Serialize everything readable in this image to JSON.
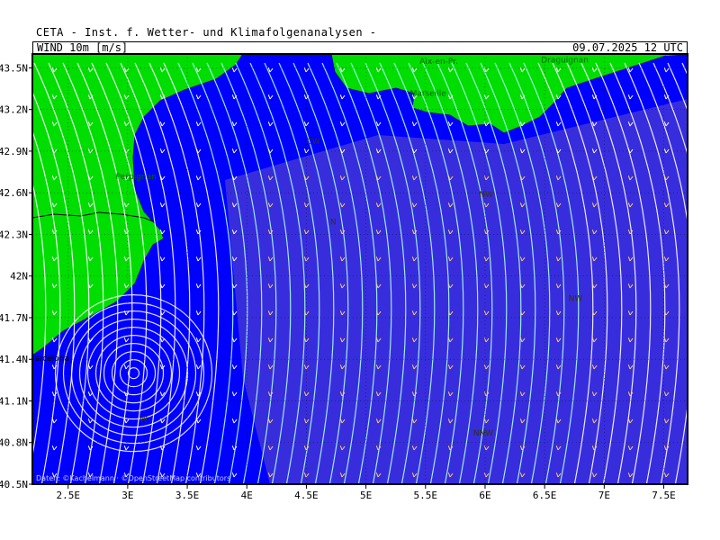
{
  "header": {
    "title": "CETA - Inst. f. Wetter- und Klimafolgenanalysen -",
    "variable": "WIND 10m [m/s]",
    "valid_time": "09.07.2025 12 UTC"
  },
  "map": {
    "lon_range": [
      2.2,
      7.7
    ],
    "lat_range": [
      40.5,
      43.6
    ],
    "lon_ticks": [
      "2.5E",
      "3E",
      "3.5E",
      "4E",
      "4.5E",
      "5E",
      "5.5E",
      "6E",
      "6.5E",
      "7E",
      "7.5E"
    ],
    "lon_tick_values": [
      2.5,
      3.0,
      3.5,
      4.0,
      4.5,
      5.0,
      5.5,
      6.0,
      6.5,
      7.0,
      7.5
    ],
    "lat_ticks": [
      "43.5N",
      "43.2N",
      "42.9N",
      "42.6N",
      "42.3N",
      "42N",
      "41.7N",
      "41.4N",
      "41.1N",
      "40.8N",
      "40.5N"
    ],
    "lat_tick_values": [
      43.5,
      43.2,
      42.9,
      42.6,
      42.3,
      42.0,
      41.7,
      41.4,
      41.1,
      40.8,
      40.5
    ],
    "colors": {
      "sea": "#0000ff",
      "land": "#00dd00",
      "streamline": "#ffffff",
      "strong_wind": "#ffcc66",
      "moderate_wind": "#aaffee"
    },
    "cities": [
      {
        "name": "Perpignan",
        "lon": 2.9,
        "lat": 42.7,
        "color": "#006600"
      },
      {
        "name": "Barcelona",
        "lon": 2.17,
        "lat": 41.39,
        "color": "#000000"
      },
      {
        "name": "Marseille",
        "lon": 5.37,
        "lat": 43.3,
        "color": "#006600"
      },
      {
        "name": "Aix-en-Pr.",
        "lon": 5.45,
        "lat": 43.53,
        "color": "#006600"
      },
      {
        "name": "Draguignan",
        "lon": 6.47,
        "lat": 43.54,
        "color": "#006600"
      }
    ],
    "wind_labels": [
      {
        "text": "CW",
        "lon": 4.5,
        "lat": 42.95
      },
      {
        "text": "N",
        "lon": 4.7,
        "lat": 42.37
      },
      {
        "text": "NW",
        "lon": 5.95,
        "lat": 42.57
      },
      {
        "text": "NW",
        "lon": 6.7,
        "lat": 41.82
      },
      {
        "text": "W",
        "lon": 3.1,
        "lat": 40.95
      },
      {
        "text": "NNW",
        "lon": 5.9,
        "lat": 40.85
      }
    ],
    "credit": "Daten: ©Kachelmann · ©OpenStreetMap contributors"
  }
}
